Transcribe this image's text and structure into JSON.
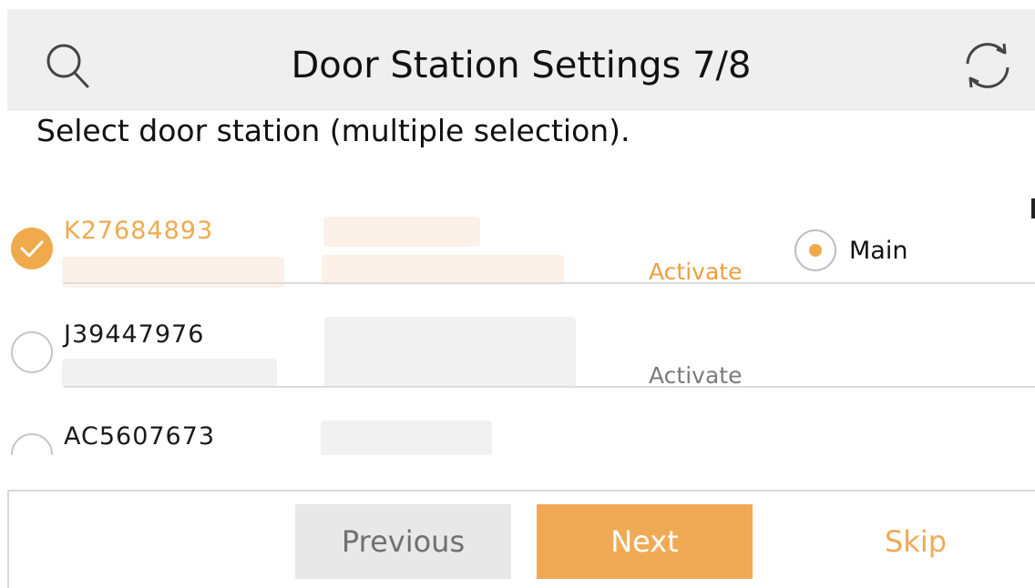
{
  "header": {
    "title": "Door Station Settings 7/8",
    "search_icon": "search-icon",
    "refresh_icon": "refresh-icon"
  },
  "instruction": "Select door station (multiple selection).",
  "stations": [
    {
      "serial": "K27684893",
      "selected": true,
      "action": "Activate",
      "role_label": "Main",
      "role_selected": true
    },
    {
      "serial": "J39447976",
      "selected": false,
      "action": "Activate"
    },
    {
      "serial": "AC5607673",
      "selected": false
    }
  ],
  "footer": {
    "previous_label": "Previous",
    "next_label": "Next",
    "skip_label": "Skip"
  },
  "colors": {
    "accent": "#f0aa4d",
    "header_bg": "#efefef",
    "disabled_bg": "#e8e8e8"
  }
}
